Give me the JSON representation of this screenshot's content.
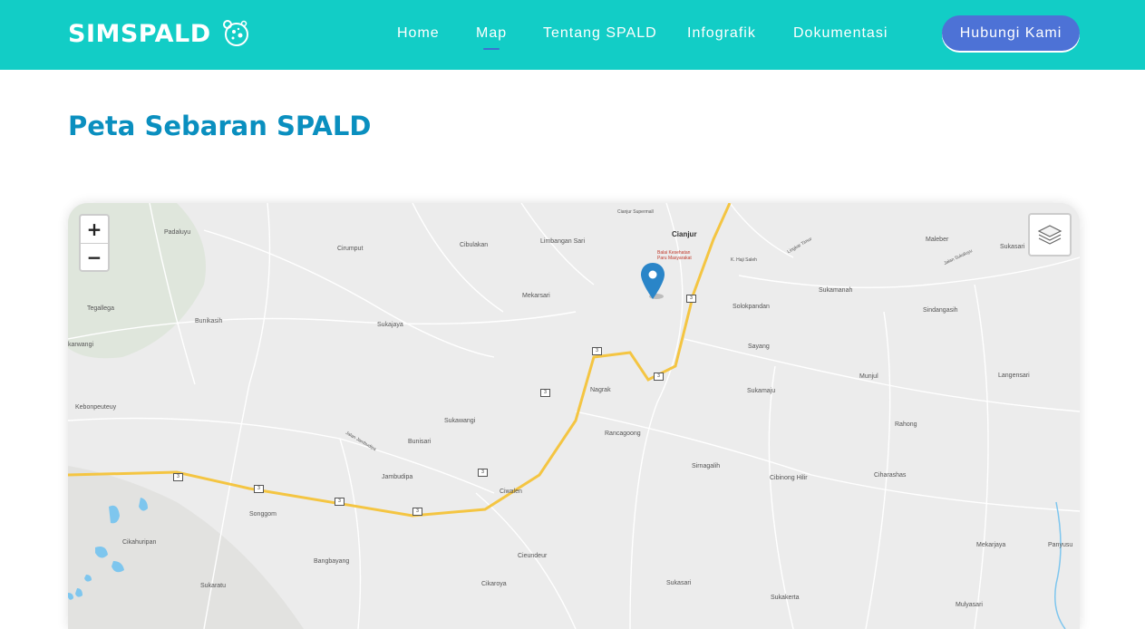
{
  "brand": {
    "name": "SIMSPALD"
  },
  "nav": {
    "items": [
      {
        "label": "Home"
      },
      {
        "label": "Map",
        "active": true
      },
      {
        "label": "Tentang SPALD"
      },
      {
        "label": "Infografik"
      },
      {
        "label": "Dokumentasi"
      }
    ],
    "cta_label": "Hubungi Kami"
  },
  "page": {
    "title": "Peta Sebaran SPALD"
  },
  "map": {
    "zoom_in": "+",
    "zoom_out": "−",
    "places": [
      "Padaluyu",
      "Cirumput",
      "Cibulakan",
      "Limbangan Sari",
      "Cianjur",
      "Cianjur Supermall",
      "Balai Kesehatan Paru Masyarakat",
      "K. Haji Saleh",
      "Maleber",
      "Sukasari",
      "Jalan Sukaluyu",
      "Tegallega",
      "Bunikasih",
      "Mekarsari",
      "Sukajaya",
      "Solokpandan",
      "Sukamanah",
      "Sindangasih",
      "Sayang",
      "karwangi",
      "Munjul",
      "Langensari",
      "Nagrak",
      "Sukamaju",
      "Kebonpeuteuy",
      "Sukawangi",
      "Rancagoong",
      "Rahong",
      "Bunisari",
      "Jalan Jambudipa",
      "Sirnagalih",
      "Cibinong Hilir",
      "Ciharashas",
      "Jambudipa",
      "Ciwalen",
      "Songgom",
      "Cikahuripan",
      "Mekarjaya",
      "Panyusu",
      "Bangbayang",
      "Cieundeur",
      "Sukaratu",
      "Cikaroya",
      "Sukasari",
      "Sukakerta",
      "Mulyasari",
      "Lingkar Timur"
    ],
    "road_number": "3"
  }
}
